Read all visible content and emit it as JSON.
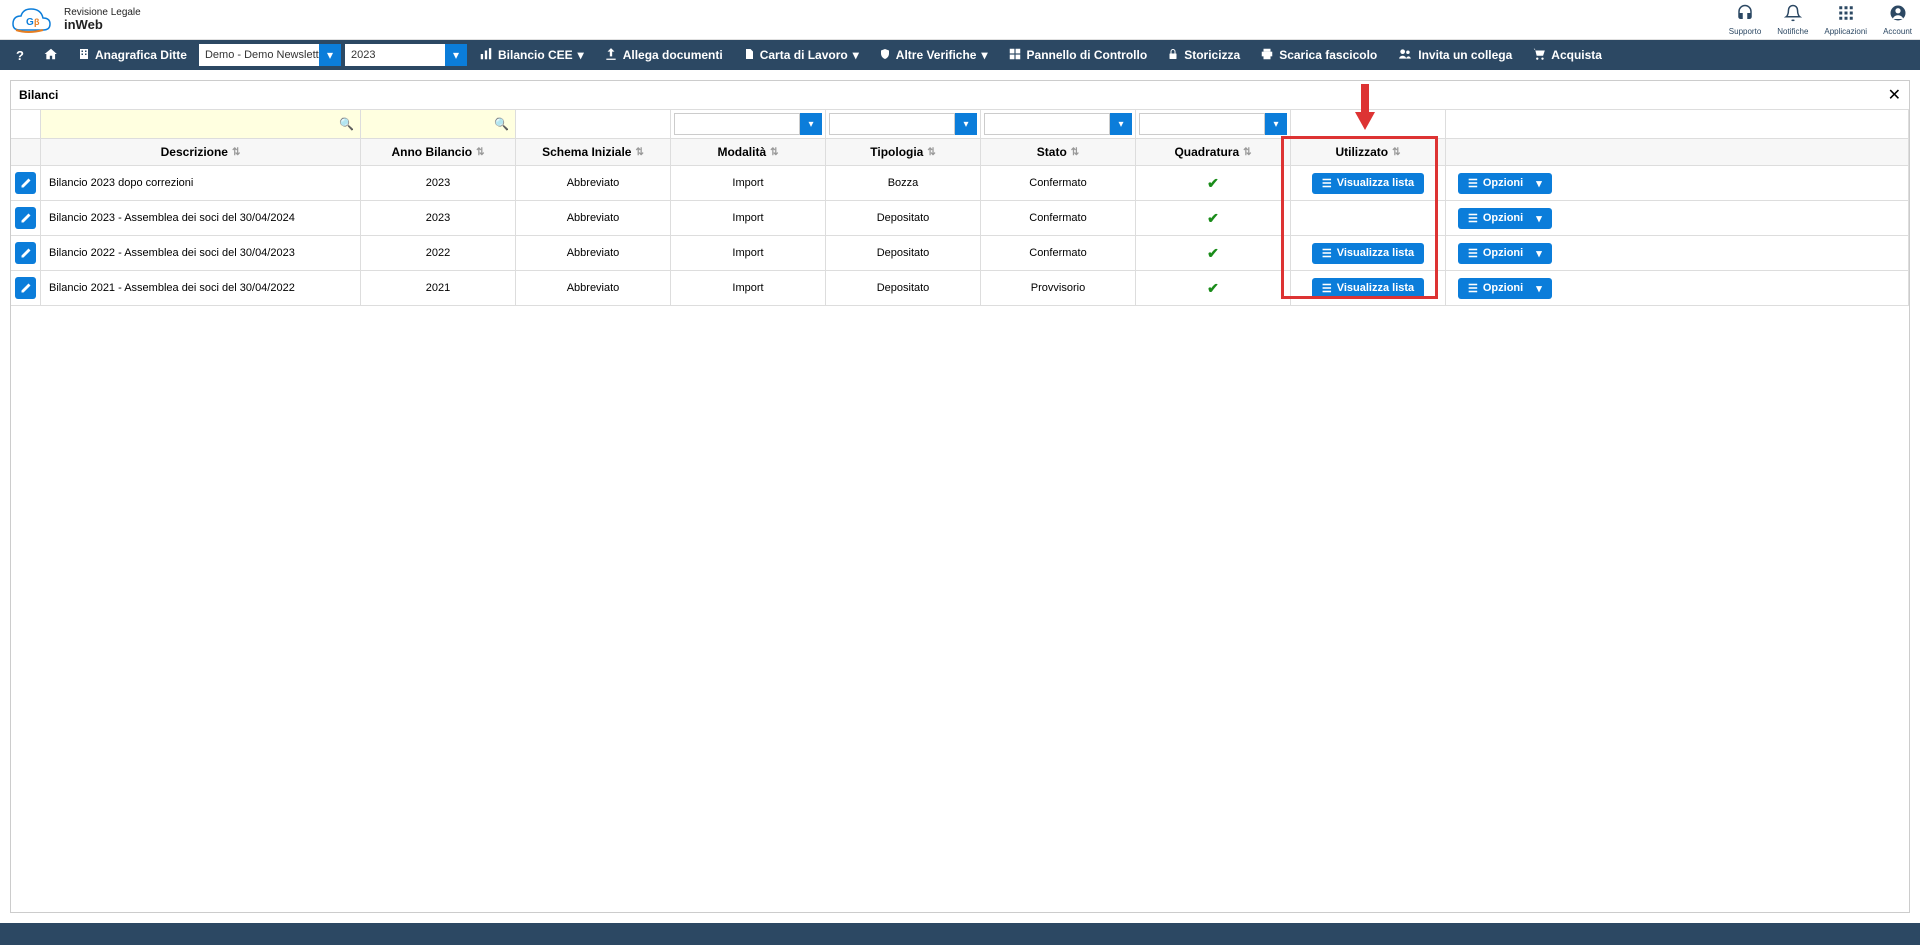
{
  "header": {
    "logo_line1": "Revisione Legale",
    "logo_line2": "inWeb",
    "icons": [
      {
        "icon": "🎧",
        "label": "Supporto"
      },
      {
        "icon": "🔔",
        "label": "Notifiche"
      },
      {
        "icon": "⊞",
        "label": "Applicazioni"
      },
      {
        "icon": "👤",
        "label": "Account"
      }
    ]
  },
  "toolbar": {
    "anagrafica": "Anagrafica Ditte",
    "company_value": "Demo - Demo Newsletter S",
    "year_value": "2023",
    "items": [
      {
        "icon": "📊",
        "label": "Bilancio CEE",
        "dropdown": true
      },
      {
        "icon": "⬆",
        "label": "Allega documenti",
        "dropdown": false
      },
      {
        "icon": "📄",
        "label": "Carta di Lavoro",
        "dropdown": true
      },
      {
        "icon": "⛨",
        "label": "Altre Verifiche",
        "dropdown": true
      },
      {
        "icon": "⊞",
        "label": "Pannello di Controllo",
        "dropdown": false
      },
      {
        "icon": "🔒",
        "label": "Storicizza",
        "dropdown": false
      },
      {
        "icon": "🖨",
        "label": "Scarica fascicolo",
        "dropdown": false
      },
      {
        "icon": "👥",
        "label": "Invita un collega",
        "dropdown": false
      },
      {
        "icon": "🛒",
        "label": "Acquista",
        "dropdown": false
      }
    ]
  },
  "panel": {
    "title": "Bilanci",
    "columns": {
      "descrizione": "Descrizione",
      "anno": "Anno Bilancio",
      "schema": "Schema Iniziale",
      "modalita": "Modalità",
      "tipologia": "Tipologia",
      "stato": "Stato",
      "quadratura": "Quadratura",
      "utilizzato": "Utilizzato"
    },
    "rows": [
      {
        "descrizione": "Bilancio 2023 dopo correzioni",
        "anno": "2023",
        "schema": "Abbreviato",
        "modalita": "Import",
        "tipologia": "Bozza",
        "stato": "Confermato",
        "quadratura": "check",
        "utilizzato_btn": "Visualizza lista",
        "opzioni": "Opzioni"
      },
      {
        "descrizione": "Bilancio 2023 - Assemblea dei soci del 30/04/2024",
        "anno": "2023",
        "schema": "Abbreviato",
        "modalita": "Import",
        "tipologia": "Depositato",
        "stato": "Confermato",
        "quadratura": "check",
        "utilizzato_btn": "",
        "opzioni": "Opzioni"
      },
      {
        "descrizione": "Bilancio 2022 - Assemblea dei soci del 30/04/2023",
        "anno": "2022",
        "schema": "Abbreviato",
        "modalita": "Import",
        "tipologia": "Depositato",
        "stato": "Confermato",
        "quadratura": "check",
        "utilizzato_btn": "Visualizza lista",
        "opzioni": "Opzioni"
      },
      {
        "descrizione": "Bilancio 2021 - Assemblea dei soci del 30/04/2022",
        "anno": "2021",
        "schema": "Abbreviato",
        "modalita": "Import",
        "tipologia": "Depositato",
        "stato": "Provvisorio",
        "quadratura": "check",
        "utilizzato_btn": "Visualizza lista",
        "opzioni": "Opzioni"
      }
    ]
  }
}
